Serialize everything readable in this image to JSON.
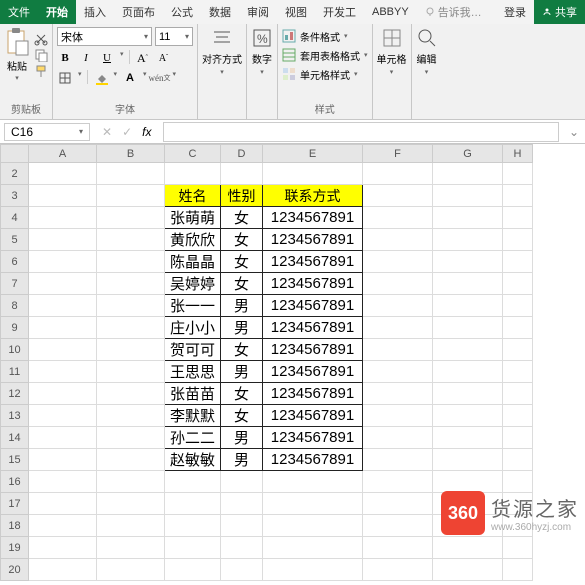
{
  "tabs": {
    "file": "文件",
    "home": "开始",
    "insert": "插入",
    "page": "页面布",
    "formula": "公式",
    "data": "数据",
    "review": "审阅",
    "view": "视图",
    "dev": "开发工",
    "abbyy": "ABBYY",
    "tell": "告诉我…",
    "login": "登录",
    "share": "共享"
  },
  "ribbon": {
    "clipboard_label": "剪贴板",
    "paste": "粘贴",
    "font_label": "字体",
    "font_name": "宋体",
    "font_size": "11",
    "align_label": "对齐方式",
    "number_label": "数字",
    "styles_label": "样式",
    "cond_fmt": "条件格式",
    "table_fmt": "套用表格格式",
    "cell_style": "单元格样式",
    "cells_label": "单元格",
    "edit_label": "编辑"
  },
  "namebox": "C16",
  "table": {
    "headers": [
      "姓名",
      "性别",
      "联系方式"
    ],
    "rows": [
      [
        "张萌萌",
        "女",
        "1234567891"
      ],
      [
        "黄欣欣",
        "女",
        "1234567891"
      ],
      [
        "陈晶晶",
        "女",
        "1234567891"
      ],
      [
        "吴婷婷",
        "女",
        "1234567891"
      ],
      [
        "张一一",
        "男",
        "1234567891"
      ],
      [
        "庄小小",
        "男",
        "1234567891"
      ],
      [
        "贺可可",
        "女",
        "1234567891"
      ],
      [
        "王思思",
        "男",
        "1234567891"
      ],
      [
        "张苗苗",
        "女",
        "1234567891"
      ],
      [
        "李默默",
        "女",
        "1234567891"
      ],
      [
        "孙二二",
        "男",
        "1234567891"
      ],
      [
        "赵敏敏",
        "男",
        "1234567891"
      ]
    ]
  },
  "cols": [
    "A",
    "B",
    "C",
    "D",
    "E",
    "F",
    "G",
    "H"
  ],
  "watermark": {
    "badge": "360",
    "main": "货源之家",
    "sub": "www.360hyzj.com"
  }
}
